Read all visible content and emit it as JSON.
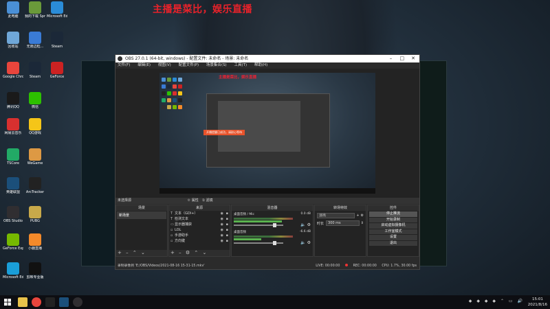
{
  "headline": "主播是菜比，娱乐直播",
  "desktop": {
    "icons": [
      {
        "label": "此电脑",
        "icon": "computer-icon",
        "color": "#4a8fd6"
      },
      {
        "label": "我的下载 Sprite",
        "icon": "download-icon",
        "color": "#6a9a3a"
      },
      {
        "label": "Microsoft Edge",
        "icon": "edge-icon",
        "color": "#2a8cd8"
      },
      {
        "label": "回收站",
        "icon": "recycle-bin-icon",
        "color": "#6fa7d8"
      },
      {
        "label": "无限边框...",
        "icon": "gear-app-icon",
        "color": "#3a7bd5"
      },
      {
        "label": "Steam",
        "icon": "steam-icon",
        "color": "#1b2838"
      },
      {
        "label": "Google Chrome",
        "icon": "chrome-icon",
        "color": "#e8453c"
      },
      {
        "label": "Steam",
        "icon": "steam-icon",
        "color": "#1b2838"
      },
      {
        "label": "GeForce",
        "icon": "geforce-icon",
        "color": "#c22"
      },
      {
        "label": "腾讯QQ",
        "icon": "qq-icon",
        "color": "#1a1a1a"
      },
      {
        "label": "微信",
        "icon": "wechat-icon",
        "color": "#2dc100"
      },
      {
        "label": "网易云音乐",
        "icon": "music-icon",
        "color": "#d8302f"
      },
      {
        "label": "QQ游戏",
        "icon": "game-icon",
        "color": "#f5c518"
      },
      {
        "label": "TSCore",
        "icon": "app-icon",
        "color": "#2a6"
      },
      {
        "label": "WeGame",
        "icon": "wegame-icon",
        "color": "#d94"
      },
      {
        "label": "英雄联盟",
        "icon": "lol-icon",
        "color": "#1b4f7a"
      },
      {
        "label": "ArcTracker",
        "icon": "arc-icon",
        "color": "#222"
      },
      {
        "label": "OBS Studio",
        "icon": "obs-icon",
        "color": "#302e31"
      },
      {
        "label": "PUBG",
        "icon": "pubg-icon",
        "color": "#c8a94a"
      },
      {
        "label": "GeForce Experience",
        "icon": "nvidia-icon",
        "color": "#76b900"
      },
      {
        "label": "小鹿直播",
        "icon": "deer-icon",
        "color": "#f48a2a"
      },
      {
        "label": "Microsoft Edge",
        "icon": "edge-icon",
        "color": "#1a9ed8"
      },
      {
        "label": "剪映专业版",
        "icon": "capcut-icon",
        "color": "#111"
      }
    ]
  },
  "obs": {
    "title": "OBS 27.0.1 (64-bit, windows) - 配置文件: 未命名 - 场景: 未命名",
    "menu": [
      "文件(F)",
      "编辑(E)",
      "视图(V)",
      "配置文件(P)",
      "场景集合(S)",
      "工具(T)",
      "帮助(H)"
    ],
    "preview": {
      "headline": "主播是菜比，娱乐直播",
      "notice": "开播提醒已成功，请耐心等待"
    },
    "scene_bar": {
      "label": "未选择源",
      "properties": "属性",
      "filters": "滤镜"
    },
    "docks": {
      "scenes": {
        "title": "场景",
        "items": [
          "新场景"
        ]
      },
      "sources": {
        "title": "来源",
        "items": [
          {
            "name": "文本（GDI+）",
            "icon": "text-icon"
          },
          {
            "name": "检测文本",
            "icon": "text-icon"
          },
          {
            "name": "显示器捕获",
            "icon": "monitor-icon"
          },
          {
            "name": "LOL",
            "icon": "window-icon"
          },
          {
            "name": "手游助手",
            "icon": "window-icon"
          },
          {
            "name": "方向键",
            "icon": "window-icon"
          }
        ]
      },
      "mixer": {
        "title": "混音器",
        "channels": [
          {
            "name": "桌面音频 / Mic",
            "db": "0.0 dB"
          },
          {
            "name": "桌面音频",
            "db": "-6.6 dB"
          }
        ]
      },
      "transitions": {
        "title": "转场特效",
        "type_label": "淡出",
        "duration_label": "时长",
        "duration": "300 ms"
      },
      "controls": {
        "title": "控件",
        "buttons": [
          "停止推流",
          "开始录制",
          "启动虚拟摄像机",
          "工作室模式",
          "设置",
          "退出"
        ]
      }
    },
    "status": {
      "recording_path": "录制录像到 'E:/OBS/Videos/2021-08-16 15-31-15.mkv'",
      "live": "LIVE: 00:00:00",
      "rec": "REC: 00:00:00",
      "cpu": "CPU: 1.7%, 30.00 fps"
    }
  },
  "taskbar": {
    "time": "15:01",
    "date": "2021/8/16"
  },
  "colors": {
    "headline": "#e8222a",
    "obs_bg": "#2b2b2b",
    "meter_green": "#5ab34f"
  }
}
